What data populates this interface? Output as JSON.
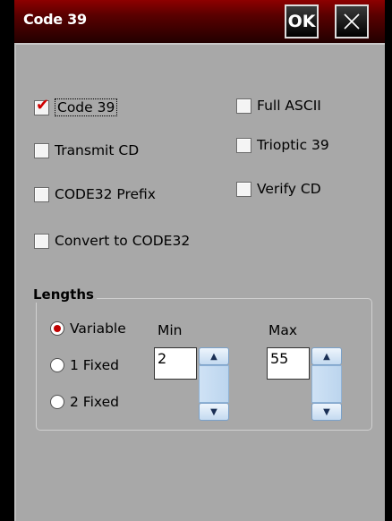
{
  "dialog": {
    "title": "Code 39",
    "ok_label": "OK"
  },
  "options": {
    "code39": {
      "label": "Code 39",
      "checked": true
    },
    "transmit_cd": {
      "label": "Transmit CD",
      "checked": false
    },
    "code32_prefix": {
      "label": "CODE32 Prefix",
      "checked": false
    },
    "convert_code32": {
      "label": "Convert to CODE32",
      "checked": false
    },
    "full_ascii": {
      "label": "Full ASCII",
      "checked": false
    },
    "trioptic39": {
      "label": "Trioptic 39",
      "checked": false
    },
    "verify_cd": {
      "label": "Verify CD",
      "checked": false
    }
  },
  "lengths": {
    "title": "Lengths",
    "modes": [
      {
        "label": "Variable",
        "selected": true
      },
      {
        "label": "1 Fixed",
        "selected": false
      },
      {
        "label": "2 Fixed",
        "selected": false
      }
    ],
    "min_label": "Min",
    "max_label": "Max",
    "min_value": "2",
    "max_value": "55"
  },
  "colors": {
    "title_bar": "#5a0000",
    "panel": "#a8a8a8",
    "check_accent": "#d00000"
  }
}
